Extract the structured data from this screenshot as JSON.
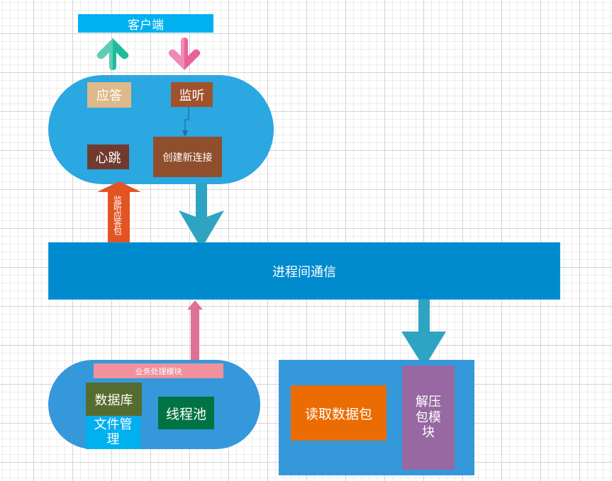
{
  "diagram": {
    "client": {
      "label": "客户端",
      "color": "#00b0ef"
    },
    "top_module": {
      "color": "#2ba7e1",
      "reply": {
        "label": "应答",
        "color": "#dfb98a"
      },
      "listen": {
        "label": "监听",
        "color": "#a0522d"
      },
      "heartbeat": {
        "label": "心跳",
        "color": "#713a2e"
      },
      "new_connection": {
        "label": "创建新连接",
        "color": "#904f2c"
      }
    },
    "ipc": {
      "label": "进程间通信",
      "color": "#008bcf"
    },
    "listen_reply_arrow": {
      "label": "监听应答包",
      "color": "#e25423"
    },
    "business_module": {
      "label": "业务处理模块",
      "color": "#f0919b",
      "database": {
        "label": "数据库",
        "color": "#566b2f"
      },
      "file_management": {
        "label": "文件管理理",
        "display": [
          "文件管",
          "理"
        ],
        "color": "#00b0ef"
      },
      "thread_pool": {
        "label": "线程池",
        "color": "#007343"
      }
    },
    "packet_module": {
      "color": "#3598db",
      "read_packet": {
        "label": "读取数据包",
        "color": "#eb6c02"
      },
      "decompress": {
        "label": "解压包模块",
        "display": [
          "解压",
          "包模",
          "块"
        ],
        "color": "#9768a1"
      }
    },
    "arrows": {
      "up_client": {
        "direction": "up",
        "color": "#1fbc9c"
      },
      "down_client": {
        "direction": "down",
        "color": "#e8629a"
      },
      "top_to_ipc": {
        "direction": "down",
        "color": "#2ea4c2"
      },
      "ipc_to_packet": {
        "direction": "down",
        "color": "#2ea4c2"
      },
      "business_to_ipc": {
        "direction": "up",
        "color": "#df7096"
      },
      "listen_to_newconn": {
        "direction": "down",
        "color": "#1f6ea4"
      }
    }
  }
}
